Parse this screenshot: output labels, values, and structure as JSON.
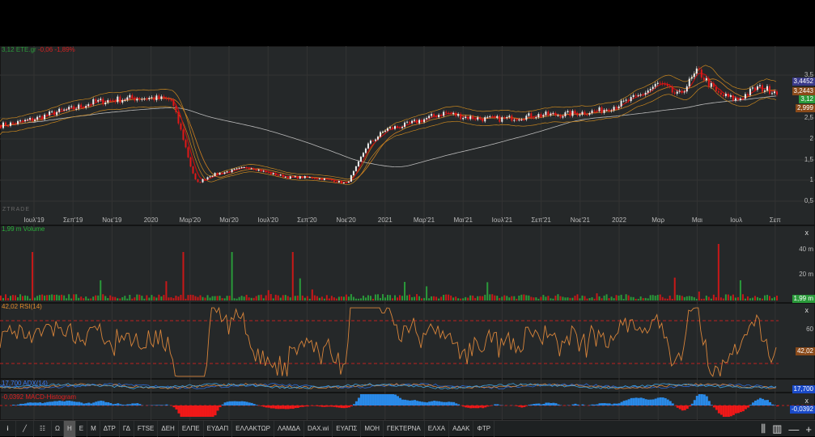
{
  "header": {
    "price": "3,12",
    "symbol": "ETE.gr",
    "change": "-0,06",
    "change_pct": "-1,89%"
  },
  "watermark": "ZTRADE",
  "colors": {
    "up": "#e8e8e8",
    "down": "#e01818",
    "green": "#2a9a3a",
    "red": "#d42020",
    "orange": "#e08a2a",
    "blue": "#2a6ad8"
  },
  "main_axis": {
    "ticks": [
      "3,5",
      "2,5",
      "2",
      "1,5",
      "1",
      "0,5"
    ],
    "tags": [
      {
        "v": "3,4452",
        "c": "#3a3a8a"
      },
      {
        "v": "3,2443",
        "c": "#8a4a1a"
      },
      {
        "v": "3,12",
        "c": "#2a9a3a"
      },
      {
        "v": "2,999",
        "c": "#8a4a1a"
      }
    ]
  },
  "x_labels": [
    "Ιουλ'19",
    "Σεπ'19",
    "Νοε'19",
    "2020",
    "Μαρ'20",
    "Μαι'20",
    "Ιουλ'20",
    "Σεπ'20",
    "Νοε'20",
    "2021",
    "Μαρ'21",
    "Μαι'21",
    "Ιουλ'21",
    "Σεπ'21",
    "Νοε'21",
    "2022",
    "Μαρ",
    "Μαι",
    "Ιουλ",
    "Σεπ"
  ],
  "volume": {
    "label": "1,99 m Volume",
    "ticks": [
      "40 m",
      "20 m"
    ],
    "tag": "1,99 m"
  },
  "rsi": {
    "label": "42,02 RSI(14)",
    "ticks": [
      "60"
    ],
    "tag": "42,02"
  },
  "adx": {
    "label": "17,700 ADX(14)",
    "tag": "17,700"
  },
  "macd": {
    "label": "-0,0392 MACD-Histogram",
    "tag": "-0,0392"
  },
  "close_label": "x",
  "toolbar": {
    "items": [
      "Ω",
      "Η",
      "Ε",
      "Μ",
      "ΔΤΡ",
      "ΓΔ",
      "FTSE",
      "ΔΕΗ",
      "ΕΛΠΕ",
      "ΕΥΔΑΠ",
      "ΕΛΛΑΚΤΩΡ",
      "ΛΑΜΔΑ",
      "DAX.wi",
      "ΕΥΑΠΣ",
      "ΜΟΗ",
      "ΓΕΚΤΕΡΝΑ",
      "ΕΛΧΑ",
      "ΑΔΑΚ",
      "ΦΤΡ"
    ],
    "active": "Η",
    "right": [
      "⫼",
      "▥",
      "—",
      "+"
    ]
  },
  "chart_data": {
    "type": "candlestick",
    "symbol": "ETE.gr",
    "ylim": [
      0.3,
      4.0
    ],
    "anchors_month_from_jul19": [
      -1.7,
      -1,
      0,
      1,
      2,
      3,
      4,
      5,
      6,
      7,
      7.6,
      8,
      8.3,
      9,
      10,
      11,
      12,
      13,
      14,
      15,
      16,
      16.5,
      17,
      18,
      19,
      20,
      21,
      22,
      23,
      24,
      25,
      26,
      27,
      28,
      29,
      30,
      31,
      32,
      33,
      34,
      35,
      36,
      37,
      38
    ],
    "close": [
      2.3,
      2.35,
      2.45,
      2.6,
      2.7,
      2.85,
      2.9,
      2.95,
      2.95,
      2.9,
      2.0,
      1.3,
      0.9,
      1.1,
      1.2,
      1.3,
      1.15,
      1.05,
      1.05,
      1.0,
      0.9,
      1.3,
      1.8,
      2.2,
      2.3,
      2.45,
      2.6,
      2.5,
      2.45,
      2.45,
      2.5,
      2.55,
      2.55,
      2.6,
      2.65,
      2.8,
      3.0,
      3.3,
      3.0,
      3.6,
      3.05,
      2.9,
      3.2,
      3.12
    ],
    "rsi_levels": [
      70,
      30
    ]
  }
}
